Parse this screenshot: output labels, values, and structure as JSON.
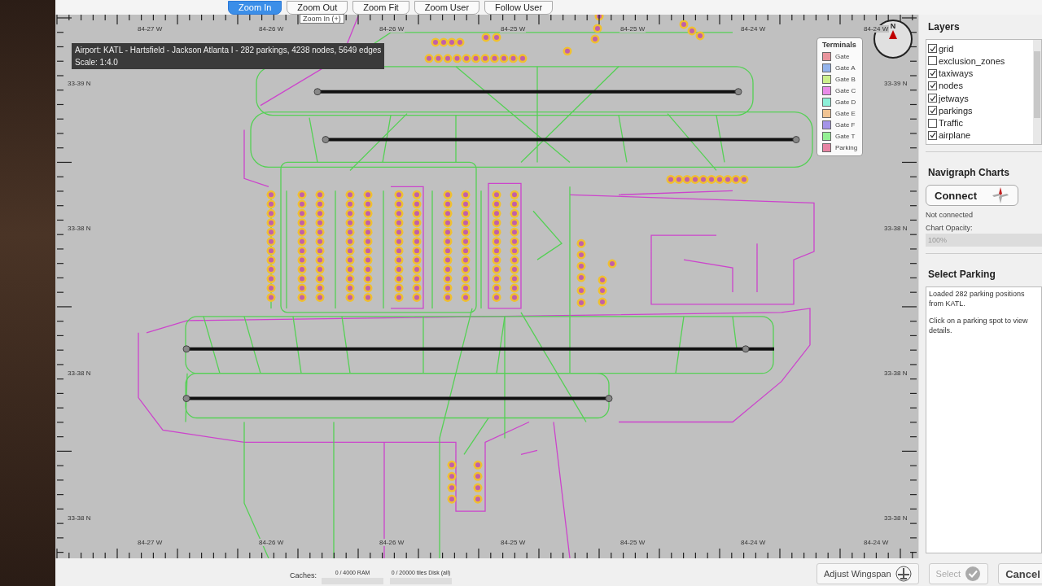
{
  "toolbar": {
    "buttons": [
      {
        "label": "Zoom In",
        "selected": true
      },
      {
        "label": "Zoom Out",
        "selected": false
      },
      {
        "label": "Zoom Fit",
        "selected": false
      },
      {
        "label": "Zoom User",
        "selected": false
      },
      {
        "label": "Follow User",
        "selected": false
      }
    ],
    "tooltip": "Zoom In (+)"
  },
  "map": {
    "info": [
      "Airport: KATL - Hartsfield - Jackson Atlanta I - 282 parkings, 4238 nodes, 5649 edges",
      "Scale: 1:4.0"
    ],
    "top_labels": [
      "84-27 W",
      "84-26 W",
      "84-26 W",
      "84-25 W",
      "84-25 W",
      "84-24 W",
      "84-24 W"
    ],
    "bottom_labels": [
      "84-27 W",
      "84-26 W",
      "84-26 W",
      "84-25 W",
      "84-25 W",
      "84-24 W",
      "84-24 W"
    ],
    "left_labels": [
      "33-39 N",
      "33-38 N",
      "33-38 N",
      "33-38 N"
    ],
    "right_labels": [
      "33-39 N",
      "33-38 N",
      "33-38 N",
      "33-38 N"
    ],
    "compass": "N",
    "legend": {
      "title": "Terminals",
      "items": [
        {
          "label": "Gate",
          "color": "#e8949c"
        },
        {
          "label": "Gate A",
          "color": "#94b4ec"
        },
        {
          "label": "Gate B",
          "color": "#ccf08c"
        },
        {
          "label": "Gate C",
          "color": "#e88ce8"
        },
        {
          "label": "Gate D",
          "color": "#8cf0d8"
        },
        {
          "label": "Gate E",
          "color": "#f0c494"
        },
        {
          "label": "Gate F",
          "color": "#a494e8"
        },
        {
          "label": "Gate T",
          "color": "#94f094"
        },
        {
          "label": "Parking",
          "color": "#e884a4"
        }
      ]
    }
  },
  "layers": {
    "title": "Layers",
    "items": [
      {
        "label": "grid",
        "checked": true
      },
      {
        "label": "exclusion_zones",
        "checked": false
      },
      {
        "label": "taxiways",
        "checked": true
      },
      {
        "label": "nodes",
        "checked": true
      },
      {
        "label": "jetways",
        "checked": true
      },
      {
        "label": "parkings",
        "checked": true
      },
      {
        "label": "Traffic",
        "checked": false
      },
      {
        "label": "airplane",
        "checked": true
      }
    ]
  },
  "navigraph": {
    "title": "Navigraph Charts",
    "button": "Connect",
    "status": "Not connected",
    "opacity_label": "Chart Opacity:",
    "opacity_value": "100%",
    "opacity_disabled": true
  },
  "select_parking": {
    "title": "Select Parking",
    "messages": [
      "Loaded 282 parking positions from KATL.",
      "Click on a parking spot to view details."
    ]
  },
  "status_bar": {
    "caches_label": "Caches:",
    "caches": [
      {
        "label": "0 / 4000 RAM",
        "level": 0
      },
      {
        "label": "0 / 20000 tiles Disk (all)",
        "level": 0
      }
    ],
    "buttons": [
      {
        "label": "Adjust Wingspan",
        "kind": "wingspan",
        "disabled": false
      },
      {
        "label": "Select",
        "kind": "select",
        "disabled": true
      },
      {
        "label": "Cancel",
        "kind": "plain",
        "disabled": false
      }
    ]
  }
}
